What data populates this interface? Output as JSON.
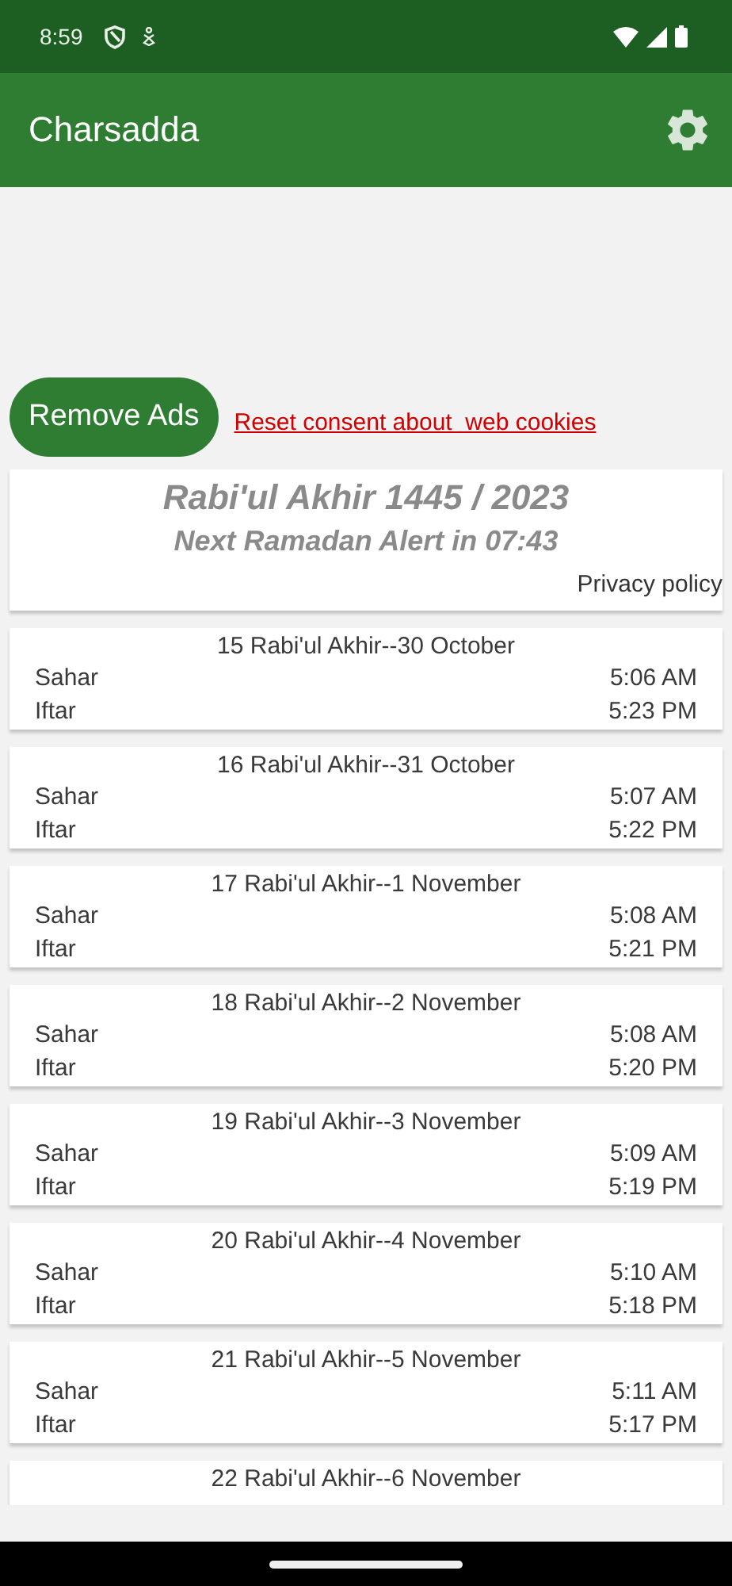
{
  "status_bar": {
    "time": "8:59"
  },
  "app_bar": {
    "title": "Charsadda"
  },
  "actions": {
    "remove_ads": "Remove Ads",
    "consent_link": "Reset consent about  web cookies"
  },
  "header": {
    "title": "Rabi'ul Akhir 1445 / 2023",
    "alert": "Next Ramadan Alert in 07:43",
    "privacy": "Privacy policy"
  },
  "days": [
    {
      "date": "15 Rabi'ul Akhir--30 October",
      "times": [
        {
          "label": "Sahar",
          "time": "5:06 AM"
        },
        {
          "label": "Iftar",
          "time": "5:23 PM"
        }
      ]
    },
    {
      "date": "16 Rabi'ul Akhir--31 October",
      "times": [
        {
          "label": "Sahar",
          "time": "5:07 AM"
        },
        {
          "label": "Iftar",
          "time": "5:22 PM"
        }
      ]
    },
    {
      "date": "17 Rabi'ul Akhir--1 November",
      "times": [
        {
          "label": "Sahar",
          "time": "5:08 AM"
        },
        {
          "label": "Iftar",
          "time": "5:21 PM"
        }
      ]
    },
    {
      "date": "18 Rabi'ul Akhir--2 November",
      "times": [
        {
          "label": "Sahar",
          "time": "5:08 AM"
        },
        {
          "label": "Iftar",
          "time": "5:20 PM"
        }
      ]
    },
    {
      "date": "19 Rabi'ul Akhir--3 November",
      "times": [
        {
          "label": "Sahar",
          "time": "5:09 AM"
        },
        {
          "label": "Iftar",
          "time": "5:19 PM"
        }
      ]
    },
    {
      "date": "20 Rabi'ul Akhir--4 November",
      "times": [
        {
          "label": "Sahar",
          "time": "5:10 AM"
        },
        {
          "label": "Iftar",
          "time": "5:18 PM"
        }
      ]
    },
    {
      "date": "21 Rabi'ul Akhir--5 November",
      "times": [
        {
          "label": "Sahar",
          "time": "5:11 AM"
        },
        {
          "label": "Iftar",
          "time": "5:17 PM"
        }
      ]
    },
    {
      "date": "22 Rabi'ul Akhir--6 November"
    }
  ]
}
